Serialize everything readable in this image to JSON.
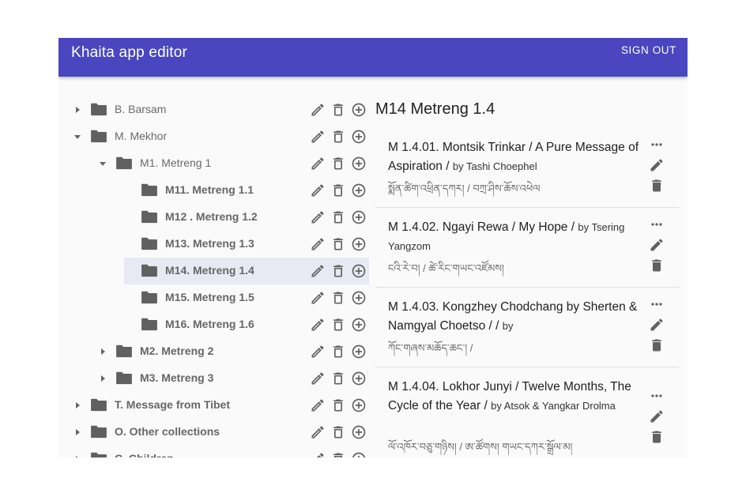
{
  "appbar": {
    "title": "Khaita app editor",
    "signout": "SIGN OUT",
    "color": "#4a46bf"
  },
  "tree": {
    "items": [
      {
        "label": "B. Barsam",
        "level": 0,
        "caret": "right",
        "bold": false
      },
      {
        "label": "M. Mekhor",
        "level": 0,
        "caret": "down",
        "bold": false
      },
      {
        "label": "M1. Metreng 1",
        "level": 1,
        "caret": "down",
        "bold": false
      },
      {
        "label": "M11. Metreng 1.1",
        "level": 2,
        "caret": "none",
        "bold": true
      },
      {
        "label": "M12 . Metreng 1.2",
        "level": 2,
        "caret": "none",
        "bold": true
      },
      {
        "label": "M13. Metreng 1.3",
        "level": 2,
        "caret": "none",
        "bold": true
      },
      {
        "label": "M14. Metreng 1.4",
        "level": 2,
        "caret": "none",
        "bold": true,
        "selected": true
      },
      {
        "label": "M15. Metreng 1.5",
        "level": 2,
        "caret": "none",
        "bold": true
      },
      {
        "label": "M16. Metreng 1.6",
        "level": 2,
        "caret": "none",
        "bold": true
      },
      {
        "label": "M2. Metreng 2",
        "level": 1,
        "caret": "right",
        "bold": true
      },
      {
        "label": "M3. Metreng 3",
        "level": 1,
        "caret": "right",
        "bold": true
      },
      {
        "label": "T. Message from Tibet",
        "level": 0,
        "caret": "right",
        "bold": true
      },
      {
        "label": "O. Other collections",
        "level": 0,
        "caret": "right",
        "bold": true
      },
      {
        "label": "C. Children",
        "level": 0,
        "caret": "right",
        "bold": true
      }
    ],
    "action_icons": [
      "pencil-icon",
      "trash-icon",
      "add-circle-icon"
    ]
  },
  "detail": {
    "heading": "M14 Metreng 1.4",
    "songs": [
      {
        "title": "M 1.4.01. Montsik Trinkar / A Pure Message of Aspiration / ",
        "by": "by Tashi Choephel",
        "tibetan": "སྨོན་ཚིག་འཕྲིན་དཀར། / བཀྲ་ཤིས་ཆོས་འཕེལ"
      },
      {
        "title": "M 1.4.02. Ngayi Rewa / My Hope / ",
        "by": "by Tsering Yangzom",
        "tibetan": "ངའི་རེ་བ། / ཚེ་རིང་གཡང་འཛོམས།"
      },
      {
        "title": "M 1.4.03. Kongzhey Chodchang by Sherten & Namgyal Choetso / / ",
        "by": "by",
        "tibetan": "ཀོང་གཞས་མཆོད་ཆང་། /"
      },
      {
        "title": "M 1.4.04. Lokhor Junyi / Twelve Months, The Cycle of the Year / ",
        "by": "by Atsok & Yangkar Drolma",
        "tibetan": "ལོ་འཁོར་བཅུ་གཉིས། / ཨ་ཚོགས། གཡང་དཀར་སྒྲོལ་མ།"
      }
    ],
    "card_icons": [
      "more-horiz-icon",
      "pencil-icon",
      "trash-icon"
    ]
  }
}
